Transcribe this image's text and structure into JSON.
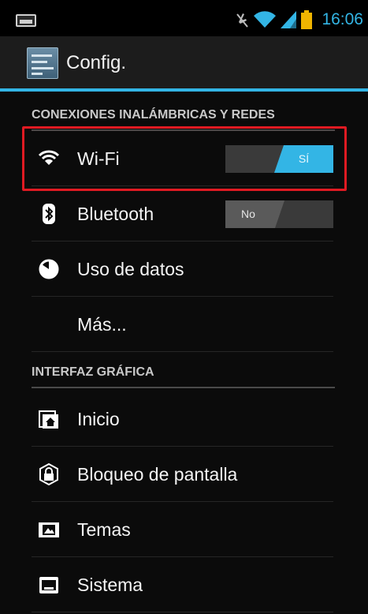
{
  "status_bar": {
    "time": "16:06",
    "icons": [
      "notification-icon",
      "mute-icon",
      "wifi-icon",
      "signal-icon",
      "battery-icon"
    ]
  },
  "action_bar": {
    "title": "Config.",
    "icon": "settings-app-icon"
  },
  "sections": [
    {
      "header": "CONEXIONES INALÁMBRICAS Y REDES",
      "items": [
        {
          "label": "Wi-Fi",
          "icon": "wifi-icon",
          "toggle": "SÍ",
          "toggle_state": "on"
        },
        {
          "label": "Bluetooth",
          "icon": "bluetooth-icon",
          "toggle": "No",
          "toggle_state": "off"
        },
        {
          "label": "Uso de datos",
          "icon": "data-usage-icon"
        },
        {
          "label": "Más..."
        }
      ]
    },
    {
      "header": "INTERFAZ GRÁFICA",
      "items": [
        {
          "label": "Inicio",
          "icon": "home-icon"
        },
        {
          "label": "Bloqueo de pantalla",
          "icon": "lock-icon"
        },
        {
          "label": "Temas",
          "icon": "themes-icon"
        },
        {
          "label": "Sistema",
          "icon": "system-icon"
        }
      ]
    }
  ],
  "colors": {
    "accent": "#33b5e5",
    "highlight": "#e01a22",
    "background": "#0b0b0b"
  }
}
